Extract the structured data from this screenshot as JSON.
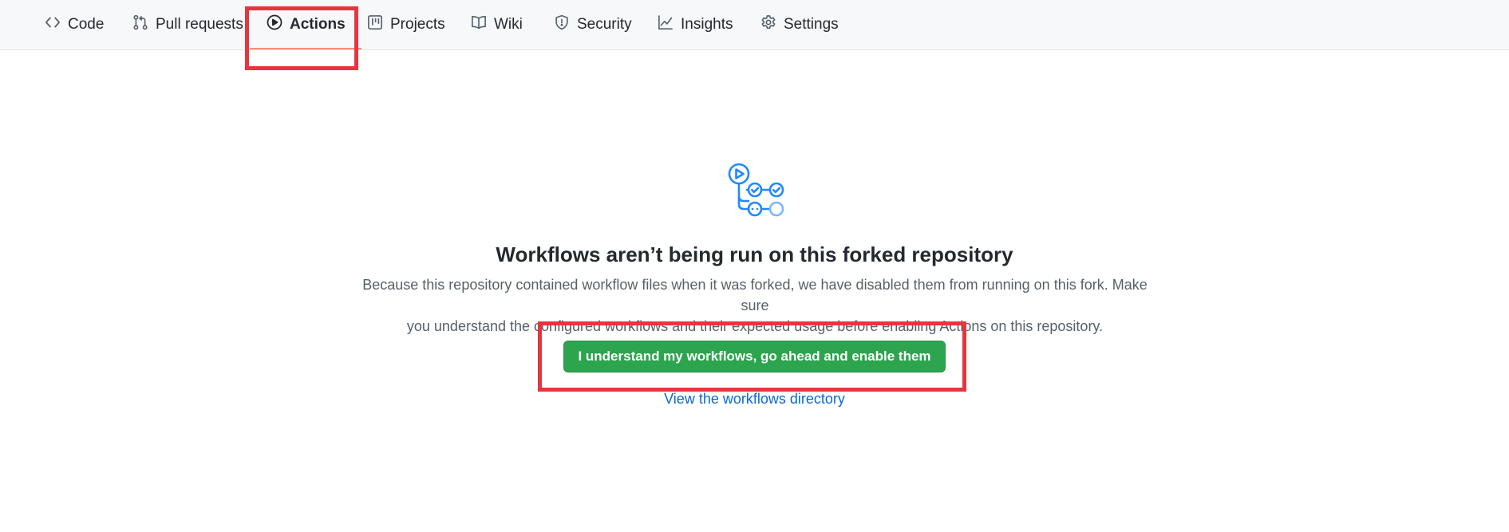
{
  "nav": {
    "tabs": [
      {
        "label": "Code",
        "icon": "code-icon"
      },
      {
        "label": "Pull requests",
        "icon": "git-pull-request-icon"
      },
      {
        "label": "Actions",
        "icon": "play-icon",
        "selected": true
      },
      {
        "label": "Projects",
        "icon": "table-icon"
      },
      {
        "label": "Wiki",
        "icon": "book-icon"
      },
      {
        "label": "Security",
        "icon": "shield-icon"
      },
      {
        "label": "Insights",
        "icon": "graph-icon"
      },
      {
        "label": "Settings",
        "icon": "gear-icon"
      }
    ]
  },
  "blankslate": {
    "icon": "workflow-icon",
    "title": "Workflows aren’t being run on this forked repository",
    "description_line1": "Because this repository contained workflow files when it was forked, we have disabled them from running on this fork. Make sure",
    "description_line2": "you understand the configured workflows and their expected usage before enabling Actions on this repository.",
    "enable_button": "I understand my workflows, go ahead and enable them",
    "directory_link": "View the workflows directory"
  },
  "colors": {
    "accent_blue": "#0969da",
    "button_green": "#2da44e",
    "highlight_red": "#e5363f",
    "selected_underline": "#fd8c73",
    "icon_blue": "#2188ff"
  }
}
